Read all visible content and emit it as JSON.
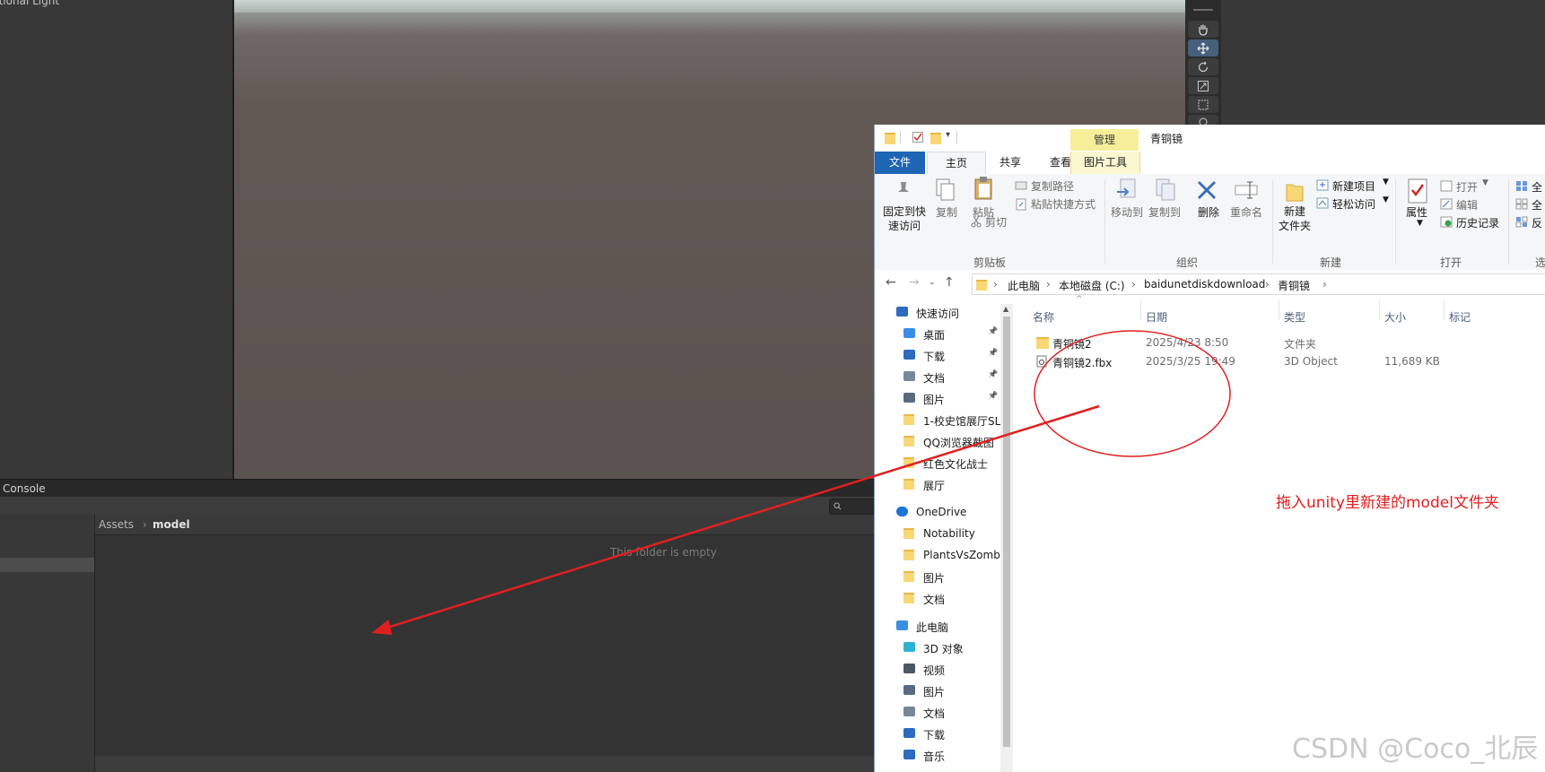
{
  "unity": {
    "hierarchy_item": "ctional Light",
    "console_tab": "Console",
    "breadcrumb_root": "Assets",
    "breadcrumb_sep": "›",
    "breadcrumb_current": "model",
    "empty_message": "This folder is empty"
  },
  "explorer": {
    "title": "青铜镜",
    "manage_tab": "管理",
    "tabs": {
      "file": "文件",
      "home": "主页",
      "share": "共享",
      "view": "查看",
      "picture_tools": "图片工具"
    },
    "ribbon": {
      "pin": "固定到快\n速访问",
      "copy": "复制",
      "paste": "粘贴",
      "copy_path": "复制路径",
      "paste_shortcut": "粘贴快捷方式",
      "cut": "剪切",
      "clipboard_group": "剪贴板",
      "move_to": "移动到",
      "copy_to": "复制到",
      "delete": "删除",
      "rename": "重命名",
      "organize_group": "组织",
      "new_folder": "新建\n文件夹",
      "new_item": "新建项目",
      "easy_access": "轻松访问",
      "new_group": "新建",
      "properties": "属性",
      "open": "打开",
      "edit": "编辑",
      "history": "历史记录",
      "open_group": "打开",
      "select_all": "全",
      "select_none": "全",
      "invert": "反",
      "select_group": "选"
    },
    "address": [
      "此电脑",
      "本地磁盘 (C:)",
      "baidunetdiskdownload",
      "青铜镜"
    ],
    "nav_items": [
      {
        "label": "快速访问",
        "icon": "star-icon",
        "pinned": false
      },
      {
        "label": "桌面",
        "icon": "desktop-icon",
        "pinned": true
      },
      {
        "label": "下载",
        "icon": "download-icon",
        "pinned": true
      },
      {
        "label": "文档",
        "icon": "document-icon",
        "pinned": true
      },
      {
        "label": "图片",
        "icon": "picture-icon",
        "pinned": true
      },
      {
        "label": "1-校史馆展厅SL",
        "icon": "folder-icon",
        "pinned": false
      },
      {
        "label": "QQ浏览器截图",
        "icon": "folder-icon",
        "pinned": false
      },
      {
        "label": "红色文化战士",
        "icon": "folder-icon",
        "pinned": false
      },
      {
        "label": "展厅",
        "icon": "folder-icon",
        "pinned": false
      },
      {
        "label": "OneDrive",
        "icon": "cloud-icon",
        "pinned": false
      },
      {
        "label": "Notability",
        "icon": "folder-icon",
        "pinned": false
      },
      {
        "label": "PlantsVsZombi",
        "icon": "folder-icon",
        "pinned": false
      },
      {
        "label": "图片",
        "icon": "folder-icon",
        "pinned": false
      },
      {
        "label": "文档",
        "icon": "folder-icon",
        "pinned": false
      },
      {
        "label": "此电脑",
        "icon": "computer-icon",
        "pinned": false
      },
      {
        "label": "3D 对象",
        "icon": "cube-icon",
        "pinned": false
      },
      {
        "label": "视频",
        "icon": "video-icon",
        "pinned": false
      },
      {
        "label": "图片",
        "icon": "picture-icon",
        "pinned": false
      },
      {
        "label": "文档",
        "icon": "document-icon",
        "pinned": false
      },
      {
        "label": "下载",
        "icon": "download-icon",
        "pinned": false
      },
      {
        "label": "音乐",
        "icon": "music-icon",
        "pinned": false
      }
    ],
    "columns": {
      "name": "名称",
      "date": "日期",
      "type": "类型",
      "size": "大小",
      "tags": "标记"
    },
    "files": [
      {
        "name": "青铜镜2",
        "date": "2025/4/23 8:50",
        "type": "文件夹",
        "size": "",
        "icon": "folder-icon"
      },
      {
        "name": "青铜镜2.fbx",
        "date": "2025/3/25 19:49",
        "type": "3D Object",
        "size": "11,689 KB",
        "icon": "3d-file-icon"
      }
    ]
  },
  "annotation": {
    "text": "拖入unity里新建的model文件夹",
    "color": "#e02020"
  },
  "watermark": "CSDN @Coco_北辰"
}
